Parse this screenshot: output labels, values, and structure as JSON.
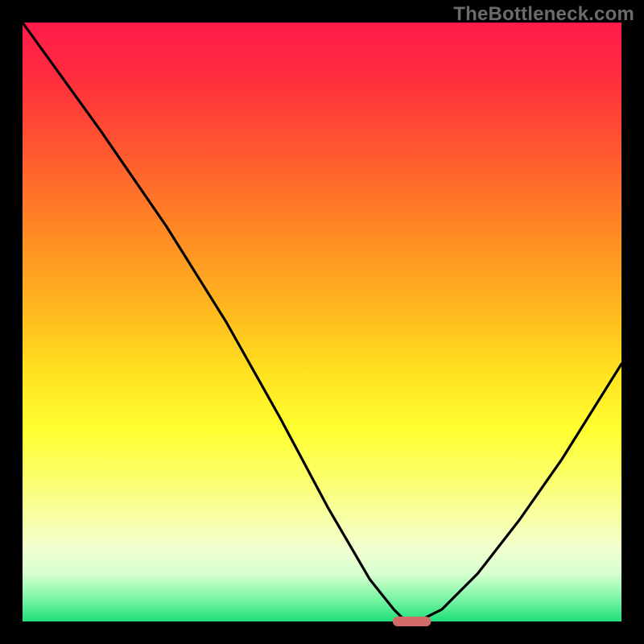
{
  "watermark": "TheBottleneck.com",
  "chart_data": {
    "type": "line",
    "title": "",
    "xlabel": "",
    "ylabel": "",
    "xlim": [
      0,
      100
    ],
    "ylim": [
      0,
      100
    ],
    "grid": false,
    "legend": false,
    "series": [
      {
        "name": "bottleneck-curve",
        "x": [
          0,
          13,
          24,
          34,
          43,
          51,
          58,
          62,
          64,
          66,
          70,
          76,
          83,
          90,
          100
        ],
        "values": [
          100,
          82,
          66,
          50,
          34,
          19,
          7,
          2,
          0,
          0,
          2,
          8,
          17,
          27,
          43
        ]
      }
    ],
    "marker": {
      "x_center": 65,
      "x_halfwidth": 3.2,
      "y": 0,
      "shape": "capsule",
      "color": "#d26a6a"
    },
    "background_gradient_stops": [
      {
        "pos": 0,
        "color": "#ff1a4b"
      },
      {
        "pos": 8,
        "color": "#ff2a3f"
      },
      {
        "pos": 22,
        "color": "#ff5a2f"
      },
      {
        "pos": 35,
        "color": "#ff8a24"
      },
      {
        "pos": 48,
        "color": "#ffb81f"
      },
      {
        "pos": 58,
        "color": "#ffe01f"
      },
      {
        "pos": 68,
        "color": "#ffff30"
      },
      {
        "pos": 76,
        "color": "#fbff6a"
      },
      {
        "pos": 83,
        "color": "#f8ffa8"
      },
      {
        "pos": 88,
        "color": "#f0ffd0"
      },
      {
        "pos": 92,
        "color": "#d8ffd0"
      },
      {
        "pos": 96,
        "color": "#80f5a8"
      },
      {
        "pos": 100,
        "color": "#1fe07a"
      }
    ]
  }
}
